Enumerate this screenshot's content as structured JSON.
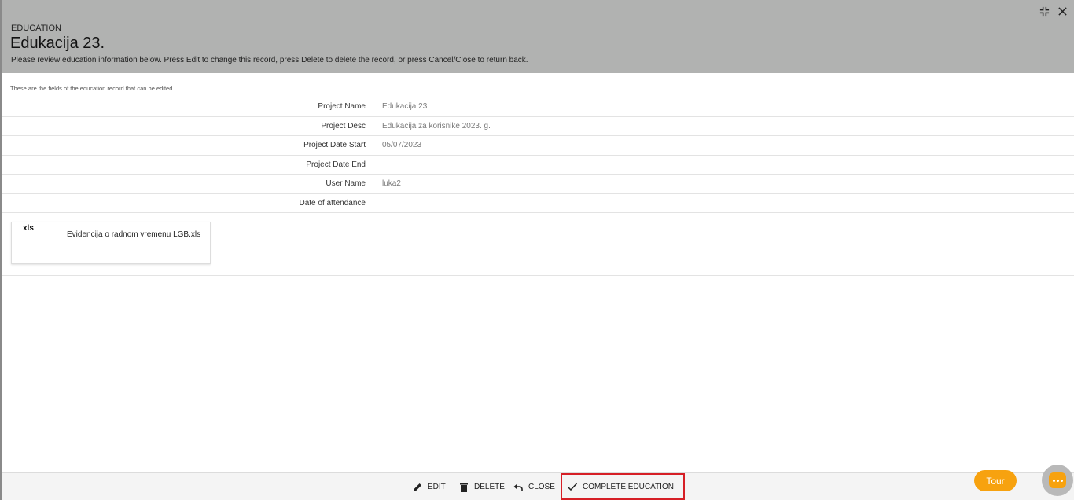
{
  "header": {
    "kicker": "EDUCATION",
    "title": "Edukacija 23.",
    "subtitle": "Please review education information below. Press Edit to change this record, press Delete to delete the record, or press Cancel/Close to return back."
  },
  "section": {
    "note": "These are the fields of the education record that can be edited."
  },
  "fields": [
    {
      "label": "Project Name",
      "value": "Edukacija 23."
    },
    {
      "label": "Project Desc",
      "value": "Edukacija za korisnike 2023. g."
    },
    {
      "label": "Project Date Start",
      "value": "05/07/2023"
    },
    {
      "label": "Project Date End",
      "value": ""
    },
    {
      "label": "User Name",
      "value": "luka2"
    },
    {
      "label": "Date of attendance",
      "value": ""
    }
  ],
  "attachment": {
    "ext": "xls",
    "filename": "Evidencija o radnom vremenu LGB.xls"
  },
  "toolbar": {
    "edit": "EDIT",
    "delete": "DELETE",
    "close": "CLOSE",
    "complete": "COMPLETE EDUCATION"
  },
  "tour": "Tour",
  "colors": {
    "header_bg": "#b1b2b1",
    "accent_orange": "#f7a20f",
    "highlight_red": "#d61f26"
  },
  "icons": [
    "collapse-icon",
    "close-icon",
    "pencil-icon",
    "trash-icon",
    "undo-icon",
    "checkmark-icon",
    "chat-icon"
  ]
}
